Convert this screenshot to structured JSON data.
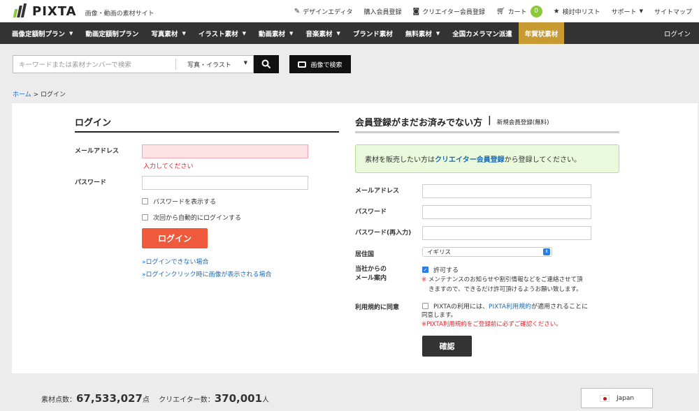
{
  "header": {
    "logo_text": "PIXTA",
    "tagline": "画像・動画の素材サイト",
    "links": [
      {
        "icon": "pencil-icon",
        "label": "デザインエディタ"
      },
      {
        "icon": "",
        "label": "購入会員登録"
      },
      {
        "icon": "camera-icon",
        "label": "クリエイター会員登録"
      },
      {
        "icon": "cart-icon",
        "label": "カート"
      },
      {
        "icon": "star-icon",
        "label": "検討中リスト"
      },
      {
        "icon": "",
        "label": "サポート"
      },
      {
        "icon": "",
        "label": "サイトマップ"
      }
    ],
    "cart_count": "0"
  },
  "nav": {
    "items": [
      {
        "label": "画像定額制プラン",
        "caret": true
      },
      {
        "label": "動画定額制プラン",
        "caret": false
      },
      {
        "label": "写真素材",
        "caret": true
      },
      {
        "label": "イラスト素材",
        "caret": true
      },
      {
        "label": "動画素材",
        "caret": true
      },
      {
        "label": "音楽素材",
        "caret": true
      },
      {
        "label": "ブランド素材",
        "caret": false
      },
      {
        "label": "無料素材",
        "caret": true
      },
      {
        "label": "全国カメラマン派遣",
        "caret": false
      },
      {
        "label": "年賀状素材",
        "caret": false,
        "highlight": true
      }
    ],
    "login": "ログイン"
  },
  "search": {
    "placeholder": "キーワードまたは素材ナンバーで検索",
    "category": "写真・イラスト",
    "image_search": "画像で検索"
  },
  "breadcrumb": {
    "home": "ホーム",
    "sep": " > ",
    "current": "ログイン"
  },
  "login": {
    "title": "ログイン",
    "email_label": "メールアドレス",
    "email_error": "入力してください",
    "password_label": "パスワード",
    "show_password": "パスワードを表示する",
    "auto_login": "次回から自動的にログインする",
    "submit": "ログイン",
    "help1": "»ログインできない場合",
    "help2": "»ログインクリック時に画像が表示される場合"
  },
  "register": {
    "title": "会員登録がまだお済みでない方",
    "pipe": "|",
    "subtitle": "新規会員登録(無料)",
    "notice_pre": "素材を販売したい方は",
    "notice_link": "クリエイター会員登録",
    "notice_post": "から登録してください。",
    "email_label": "メールアドレス",
    "password_label": "パスワード",
    "password2_label": "パスワード(再入力)",
    "country_label": "居住国",
    "country_value": "イギリス",
    "mail_label_1": "当社からの",
    "mail_label_2": "メール案内",
    "allow": "許可する",
    "mail_note_mark": "※",
    "mail_note_1": "メンテナンスのお知らせや割引情報などをご連絡させて頂",
    "mail_note_2": "きますので、できるだけ許可頂けるようお願い致します。",
    "terms_label": "利用規約に同意",
    "terms_pre": "PIXTAの利用には、",
    "terms_link": "PIXTA利用規約",
    "terms_post": "が適用されることに",
    "terms_line2": "同意します。",
    "terms_warning": "※PIXTA利用規約をご登録前に必ずご確認ください。",
    "submit": "確認"
  },
  "footer": {
    "materials_label": "素材点数：",
    "materials_count": "67,533,027",
    "materials_unit": "点",
    "creators_label": "クリエイター数：",
    "creators_count": "370,001",
    "creators_unit": "人",
    "language": "Japan"
  },
  "colors": {
    "nav_bg": "#333333",
    "highlight": "#c89a32",
    "login_button": "#f05a3c",
    "link": "#1a6bb8",
    "error": "#e0222b",
    "cart_badge": "#8cc83c",
    "notice_bg": "#eaf8dc"
  }
}
